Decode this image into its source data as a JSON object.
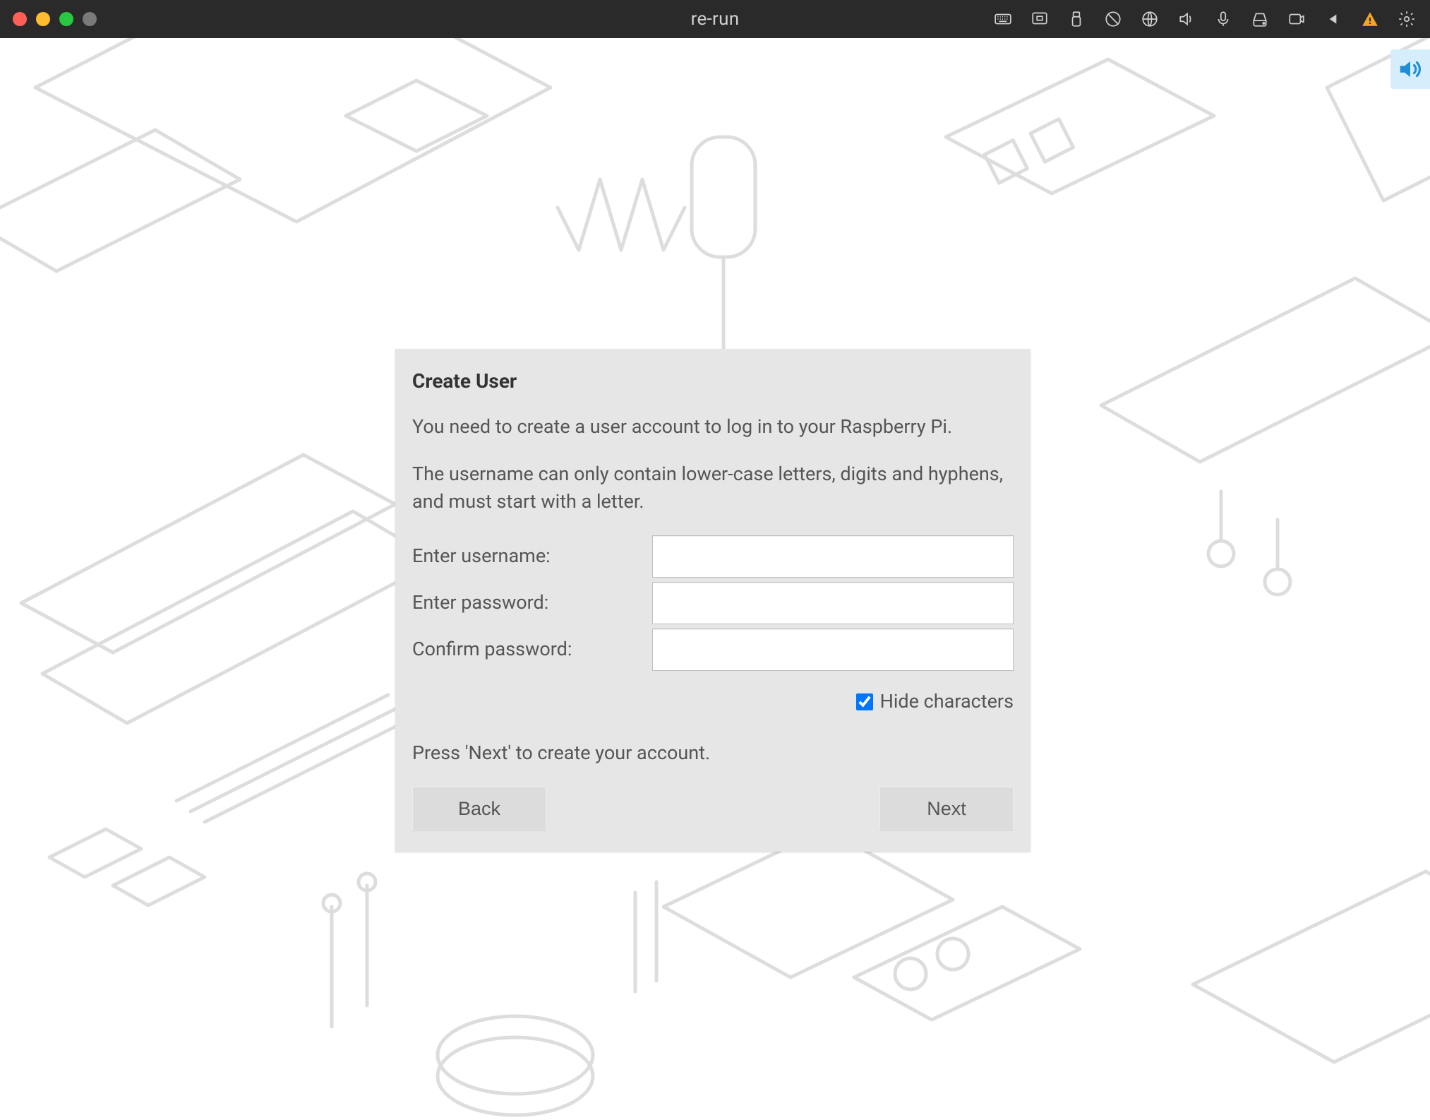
{
  "menubar": {
    "title": "re-run"
  },
  "dialog": {
    "title": "Create User",
    "intro": "You need to create a user account to log in to your Raspberry Pi.",
    "rules": "The username can only contain lower-case letters, digits and hyphens, and must start with a letter.",
    "fields": {
      "username_label": "Enter username:",
      "username_value": "",
      "password_label": "Enter password:",
      "password_value": "",
      "confirm_label": "Confirm password:",
      "confirm_value": ""
    },
    "hide_characters_label": "Hide characters",
    "hide_characters_checked": true,
    "hint": "Press 'Next' to create your account.",
    "back_label": "Back",
    "next_label": "Next"
  }
}
